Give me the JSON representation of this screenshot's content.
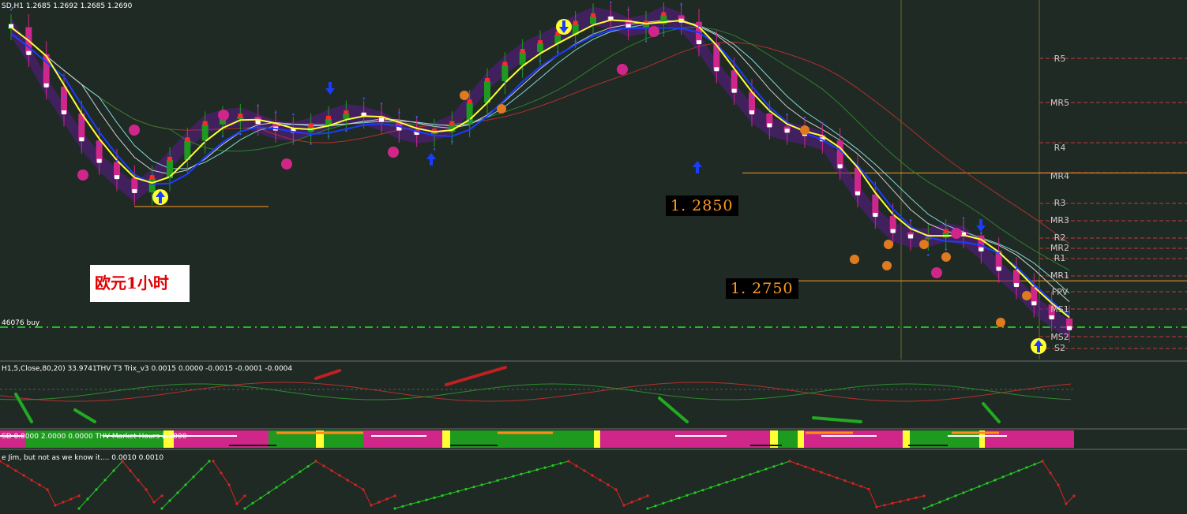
{
  "window": {
    "header": "SD,H1  1.2685 1.2692 1.2685 1.2690"
  },
  "annotation": {
    "note": "欧元1小时",
    "price_label_1": "1. 2850",
    "price_label_2": "1. 2750",
    "trade_label": "46076 buy"
  },
  "pivot_levels": [
    "R5",
    "MR5",
    "R4",
    "MR4",
    "R3",
    "MR3",
    "R2",
    "MR2",
    "R1",
    "MR1",
    "FPV",
    "MS1",
    "MS2",
    "S2"
  ],
  "panels": {
    "indicator_1_label": "H1,5,Close,80,20) 33.9741",
    "indicator_2_label": "THV T3 Trix_v3   0.0015 0.0000 -0.0015 -0.0001 -0.0004",
    "indicator_3_label": "SD 0.0000 2.0000 0.0000  THV Market Hours 2.0000",
    "indicator_4_label": "e Jim, but not as we know it....  0.0010 0.0010"
  },
  "colors": {
    "background": "#1f2a24",
    "bull_candle": "#1e9a1e",
    "bear_candle": "#d0268a",
    "yellow_ma": "#ffff33",
    "blue_ma": "#1a3cff",
    "cloud": "#5b1a8c",
    "guide_line": "#ff9922",
    "pivot_line": "#c53a3a",
    "buy_line": "#22bb22"
  },
  "chart_data": {
    "type": "line",
    "title": "SD,H1",
    "xlabel": "",
    "ylabel": "",
    "ohlc_header": {
      "open": 1.2685,
      "high": 1.2692,
      "low": 1.2685,
      "close": 1.269
    },
    "ylim": [
      1.268,
      1.3
    ],
    "horizontal_levels": [
      {
        "name": "1. 2850",
        "value": 1.285
      },
      {
        "name": "1. 2750",
        "value": 1.275
      }
    ],
    "series": [
      {
        "values": [
          1.2985,
          1.296,
          1.293,
          1.2905,
          1.288,
          1.286,
          1.2845,
          1.2832,
          1.2845,
          1.2862,
          1.288,
          1.2895,
          1.29,
          1.2902,
          1.2896,
          1.289,
          1.2888,
          1.2893,
          1.29,
          1.2905,
          1.2903,
          1.2898,
          1.289,
          1.2886,
          1.2888,
          1.2895,
          1.2915,
          1.2935,
          1.295,
          1.2962,
          1.297,
          1.2978,
          1.2988,
          1.2995,
          1.2992,
          1.2985,
          1.2988,
          1.2996,
          1.299,
          1.297,
          1.2945,
          1.2925,
          1.2905,
          1.2893,
          1.2888,
          1.2885,
          1.288,
          1.2855,
          1.283,
          1.281,
          1.2795,
          1.279,
          1.279,
          1.2795,
          1.2792,
          1.2778,
          1.276,
          1.2745,
          1.2728,
          1.2715,
          1.2705
        ]
      }
    ]
  }
}
